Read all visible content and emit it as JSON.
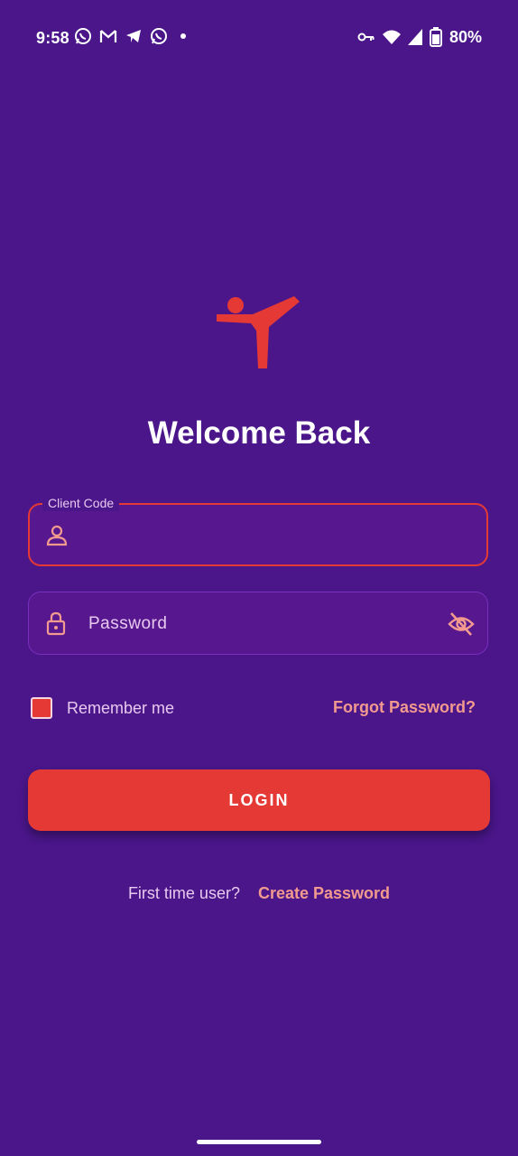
{
  "status_bar": {
    "time": "9:58",
    "left_icons": [
      "whatsapp-icon",
      "gmail-icon",
      "telegram-icon",
      "whatsapp-icon"
    ],
    "right_icons": [
      "vpn-key-icon",
      "wifi-icon",
      "signal-icon",
      "battery-saver-icon"
    ],
    "battery": "80%"
  },
  "title": "Welcome Back",
  "client_code": {
    "label": "Client Code",
    "value": "",
    "placeholder": ""
  },
  "password": {
    "placeholder": "Password",
    "value": ""
  },
  "remember": {
    "label": "Remember me",
    "checked": true
  },
  "forgot_password": "Forgot Password?",
  "login_button": "LOGIN",
  "first_time": {
    "text": "First time user?",
    "link": "Create Password"
  },
  "colors": {
    "background": "#4a168a",
    "field_bg": "#57188f",
    "accent": "#e53935",
    "link": "#f39a8f",
    "label": "#e8c9ef"
  }
}
